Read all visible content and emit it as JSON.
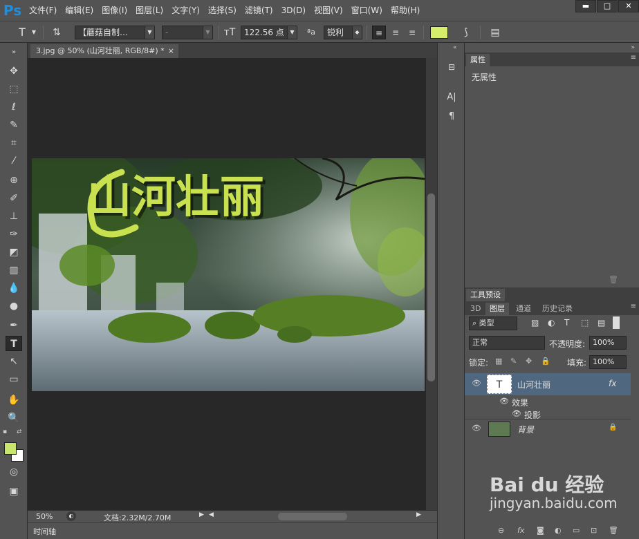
{
  "app": {
    "logo": "Ps"
  },
  "menu": [
    "文件(F)",
    "编辑(E)",
    "图像(I)",
    "图层(L)",
    "文字(Y)",
    "选择(S)",
    "滤镜(T)",
    "3D(D)",
    "视图(V)",
    "窗口(W)",
    "帮助(H)"
  ],
  "window_controls": {
    "minimize": "▬",
    "maximize": "□",
    "close": "✕"
  },
  "options": {
    "font_family": "【蘑菇自制…",
    "font_style": "-",
    "font_size": "122.56 点",
    "antialias": "锐利",
    "text_color": "#d6ee6a"
  },
  "document": {
    "tab_title": "3.jpg @ 50% (山河壮丽, RGB/8#) *",
    "tab_close": "×",
    "image_text": "山河壮丽",
    "text_color": "#c9e04f"
  },
  "status": {
    "zoom": "50%",
    "doc_info": "文档:2.32M/2.70M"
  },
  "timeline": {
    "label": "时间轴"
  },
  "dock": {
    "char_icon": "A|",
    "para_icon": "¶"
  },
  "properties": {
    "tab": "属性",
    "content": "无属性"
  },
  "layers_panel": {
    "top_tab": "工具预设",
    "tabs": [
      "3D",
      "图层",
      "通道",
      "历史记录"
    ],
    "filter_kind": "类型",
    "blend_mode": "正常",
    "opacity_label": "不透明度:",
    "opacity_value": "100%",
    "lock_label": "锁定:",
    "fill_label": "填充:",
    "fill_value": "100%",
    "layers": [
      {
        "name": "山河壮丽",
        "fx": "fx",
        "selected": true
      },
      {
        "name": "效果",
        "sub": true
      },
      {
        "name": "投影",
        "sub": true
      },
      {
        "name": "背景",
        "locked": true
      }
    ]
  },
  "foreground_color": "#c8e66c",
  "background_color": "#ffffff",
  "watermark": {
    "brand": "Bai du 经验",
    "url": "jingyan.baidu.com"
  }
}
